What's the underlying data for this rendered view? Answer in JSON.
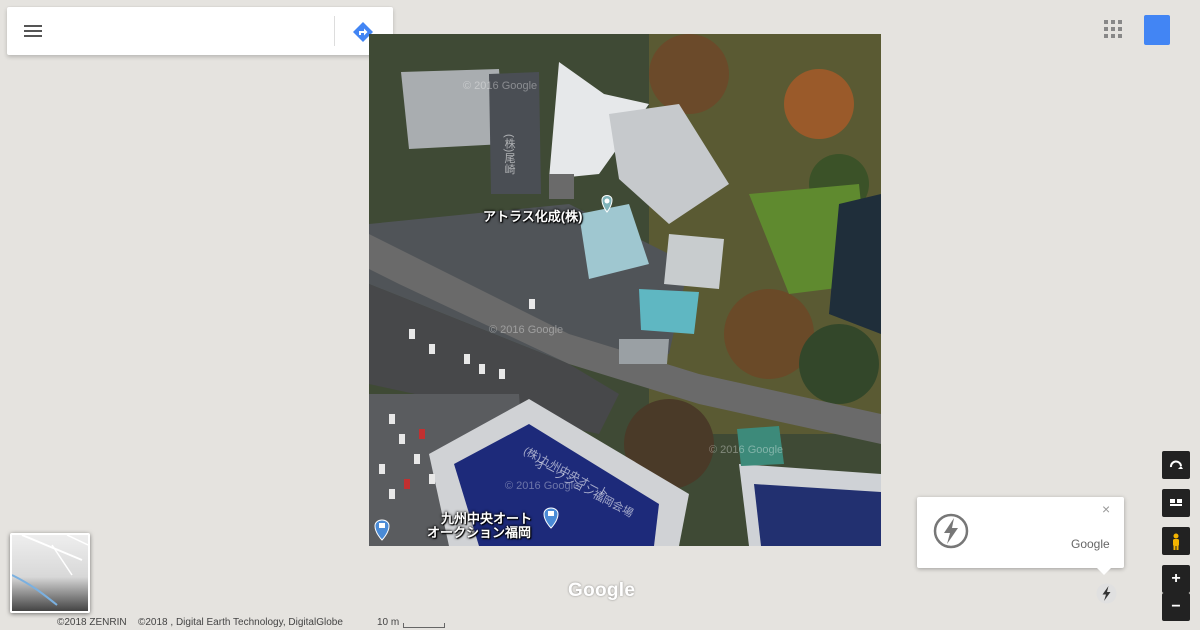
{
  "search": {
    "placeholder": "",
    "value": ""
  },
  "toolbar": {
    "menu_icon": "hamburger-menu-icon",
    "directions_icon": "directions-icon"
  },
  "header": {
    "apps_icon": "apps-grid-icon",
    "account_icon": "account-icon",
    "account_color": "#4285f4"
  },
  "map": {
    "poi_1": "アトラス化成(株)",
    "poi_2_line1": "九州中央オート",
    "poi_2_line2": "オークション福岡",
    "building_text": "(株)九州中央オート",
    "building_text_2": "オークション福岡会場",
    "vertical_text": "(株)尾崎",
    "tile_watermark": "© 2016 Google",
    "google_logo": "Google"
  },
  "attribution": {
    "zenrin": "©2018 ZENRIN",
    "imagery": "©2018 , Digital Earth Technology, DigitalGlobe",
    "scale": "10 m"
  },
  "promo": {
    "close": "×",
    "brand": "Google",
    "icon": "lightning-bolt-icon"
  },
  "controls": {
    "rotate_icon": "rotate-icon",
    "tilt_icon": "tilt-icon",
    "pegman_icon": "pegman-icon",
    "zoom_in": "+",
    "zoom_out": "−"
  },
  "colors": {
    "map_background": "#e5e3df",
    "poi_blue": "#4a8bd6",
    "control_dark": "#222222"
  }
}
